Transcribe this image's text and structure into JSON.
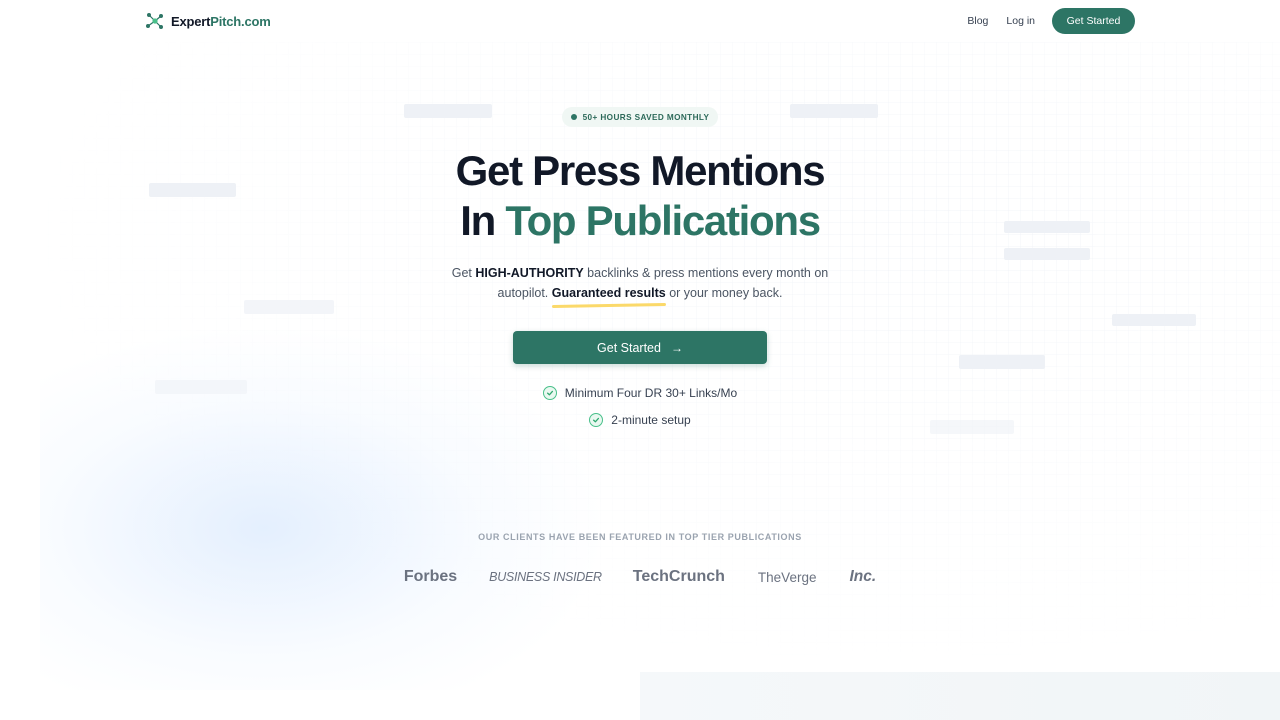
{
  "header": {
    "logo_prefix": "Expert",
    "logo_accent": "Pitch.com",
    "nav": {
      "blog": "Blog",
      "login": "Log in",
      "get_started": "Get Started"
    }
  },
  "hero": {
    "badge": "50+ HOURS SAVED MONTHLY",
    "headline_line1": "Get Press Mentions",
    "headline_line2_prefix": "In",
    "headline_line2_accent": "Top Publications",
    "subtitle": {
      "part1": "Get",
      "bold1": "HIGH-AUTHORITY",
      "part2": "backlinks & press mentions every month on autopilot.",
      "underlined": "Guaranteed results",
      "part3": "or your money back."
    },
    "cta_label": "Get Started",
    "cta_icon": "arrow-right-icon",
    "features": [
      "Minimum Four DR 30+ Links/Mo",
      "2-minute setup"
    ]
  },
  "featured": {
    "label": "OUR CLIENTS HAVE BEEN FEATURED IN TOP TIER PUBLICATIONS",
    "publications": [
      "Forbes",
      "BUSINESS INSIDER",
      "TechCrunch",
      "TheVerge",
      "Inc."
    ]
  },
  "colors": {
    "brand": "#2d7565",
    "check": "#49c08a",
    "highlight": "#fbd96a"
  }
}
